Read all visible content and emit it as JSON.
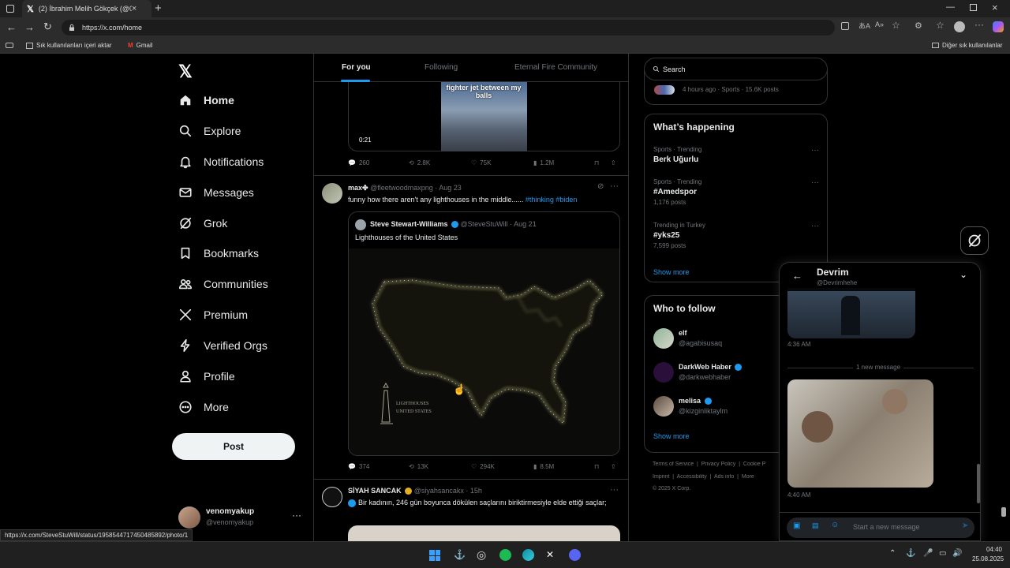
{
  "browser": {
    "tab_title": "(2) İbrahim Melih Gökçek (@06m",
    "url": "https://x.com/home",
    "bookmarks": [
      "Sık kullanılanları içeri aktar",
      "Gmail"
    ],
    "other_bookmarks": "Diğer sık kullanılanlar",
    "status_url": "https://x.com/SteveStuWill/status/1958544717450485892/photo/1"
  },
  "nav": {
    "items": [
      {
        "label": "Home",
        "icon": "home-icon"
      },
      {
        "label": "Explore",
        "icon": "search-icon"
      },
      {
        "label": "Notifications",
        "icon": "bell-icon"
      },
      {
        "label": "Messages",
        "icon": "mail-icon"
      },
      {
        "label": "Grok",
        "icon": "grok-icon"
      },
      {
        "label": "Bookmarks",
        "icon": "bookmark-icon"
      },
      {
        "label": "Communities",
        "icon": "people-icon"
      },
      {
        "label": "Premium",
        "icon": "x-icon"
      },
      {
        "label": "Verified Orgs",
        "icon": "bolt-icon"
      },
      {
        "label": "Profile",
        "icon": "person-icon"
      },
      {
        "label": "More",
        "icon": "more-icon"
      }
    ],
    "post_label": "Post",
    "account": {
      "name": "venomyakup",
      "handle": "@venomyakup"
    }
  },
  "feed": {
    "tabs": [
      "For you",
      "Following",
      "Eternal Fire Community"
    ],
    "top_post": {
      "video_caption": "fighter jet between my balls",
      "duration": "0:21",
      "replies": "260",
      "reposts": "2.8K",
      "likes": "75K",
      "views": "1.2M"
    },
    "post1": {
      "name": "max✤",
      "handle": "@fleetwoodmaxpng",
      "date": "· Aug 23",
      "text": "funny how there aren't any lighthouses in the middle......",
      "hashtags": "#thinking #biden",
      "quote": {
        "name": "Steve Stewart-Williams",
        "handle": "@SteveStuWill",
        "date": "· Aug 21",
        "text": "Lighthouses of the United States",
        "image_label_1": "LIGHTHOUSES",
        "image_label_2": "UNITED STATES"
      },
      "replies": "374",
      "reposts": "13K",
      "likes": "294K",
      "views": "8.5M"
    },
    "post2": {
      "name": "SİYAH SANCAK",
      "handle": "@siyahsancakx",
      "date": "· 15h",
      "text": "Bir kadının, 246 gün boyunca dökülen saçlarını biriktirmesiyle elde ettiği saçlar;"
    }
  },
  "right": {
    "search_placeholder": "Search",
    "top_meta": "4 hours ago · Sports · 15.6K posts",
    "whats_happening": "What’s happening",
    "trends": [
      {
        "context": "Sports · Trending",
        "name": "Berk Uğurlu",
        "count": ""
      },
      {
        "context": "Sports · Trending",
        "name": "#Amedspor",
        "count": "1,176 posts"
      },
      {
        "context": "Trending in Turkey",
        "name": "#yks25",
        "count": "7,599 posts"
      }
    ],
    "show_more": "Show more",
    "who_to_follow": "Who to follow",
    "follow": [
      {
        "name": "elf",
        "handle": "@agabisusaq"
      },
      {
        "name": "DarkWeb Haber",
        "handle": "@darkwebhaber"
      },
      {
        "name": "melisa",
        "handle": "@kizginliktaylm"
      }
    ],
    "footer_1": [
      "Terms of Service",
      "Privacy Policy",
      "Cookie P"
    ],
    "footer_2": [
      "Imprint",
      "Accessibility",
      "Ads info",
      "More"
    ],
    "copyright": "© 2025 X Corp."
  },
  "dm": {
    "name": "Devrim",
    "handle": "@Devrimhehe",
    "time1": "4:36 AM",
    "new_message": "1 new message",
    "time2": "4:40 AM",
    "input_placeholder": "Start a new message"
  },
  "taskbar": {
    "time": "04:40",
    "date": "25.08.2025"
  }
}
